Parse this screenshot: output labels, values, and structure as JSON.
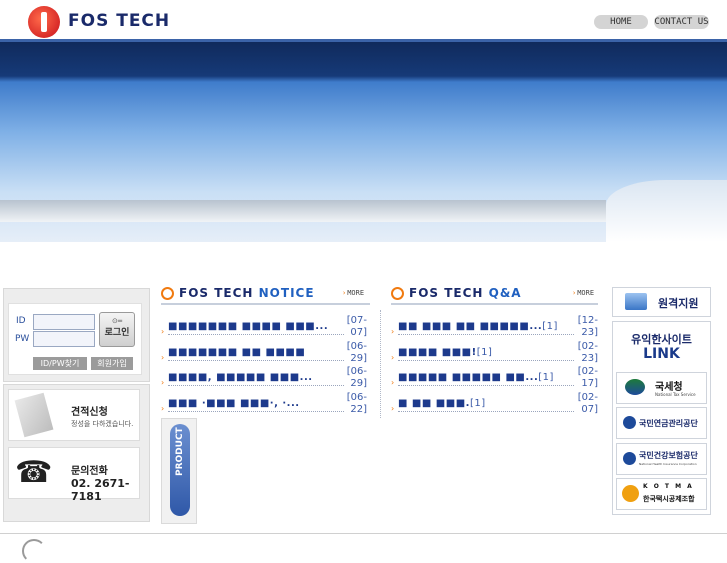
{
  "header": {
    "logo_text": "FOS TECH",
    "nav": [
      {
        "label": "HOME"
      },
      {
        "label": "CONTACT US"
      }
    ]
  },
  "login": {
    "id_label": "ID",
    "pw_label": "PW",
    "login_button": "로그인",
    "find_button": "ID/PW찾기",
    "join_button": "회원가입"
  },
  "estimate_card": {
    "title": "견적신청",
    "subtitle": "정성을 다하겠습니다."
  },
  "phone_card": {
    "title": "문의전화",
    "number": "02. 2671-7181"
  },
  "product_tab": {
    "label": "PRODUCT"
  },
  "notice": {
    "title_main": "FOS TECH ",
    "title_hl": "NOTICE",
    "more": "MORE",
    "items": [
      {
        "title": "■■■■■■■ ■■■■ ■■■...",
        "date": "[07-07]"
      },
      {
        "title": "■■■■■■■ ■■ ■■■■",
        "date": "[06-29]"
      },
      {
        "title": "■■■■, ■■■■■ ■■■...",
        "date": "[06-29]"
      },
      {
        "title": "■■■ ·■■■ ■■■·, ·...",
        "date": "[06-22]"
      }
    ]
  },
  "qa": {
    "title_main": "FOS TECH ",
    "title_hl": "Q&A",
    "more": "MORE",
    "items": [
      {
        "title": "■■ ■■■ ■■ ■■■■■...",
        "count": "[1]",
        "date": "[12-23]"
      },
      {
        "title": "■■■■ ■■■!",
        "count": "[1]",
        "date": "[02-23]"
      },
      {
        "title": "■■■■■ ■■■■■ ■■...",
        "count": "[1]",
        "date": "[02-17]"
      },
      {
        "title": "■ ■■ ■■■.",
        "count": "[1]",
        "date": "[02-07]"
      }
    ]
  },
  "right": {
    "remote_support": "원격지원",
    "link_title_1": "유익한사이트",
    "link_title_2": "LINK",
    "links": [
      {
        "label": "국세청",
        "sub": "National Tax Service"
      },
      {
        "label": "국민연금관리공단"
      },
      {
        "label": "국민건강보험공단",
        "sub": "National Health Insurance Corporation"
      },
      {
        "label": "한국택시공제조합",
        "sub": "K O T M A"
      }
    ]
  },
  "colors": {
    "brand_navy": "#1a2a6a",
    "accent_orange": "#f07a10",
    "link_blue": "#1d3a8c"
  }
}
